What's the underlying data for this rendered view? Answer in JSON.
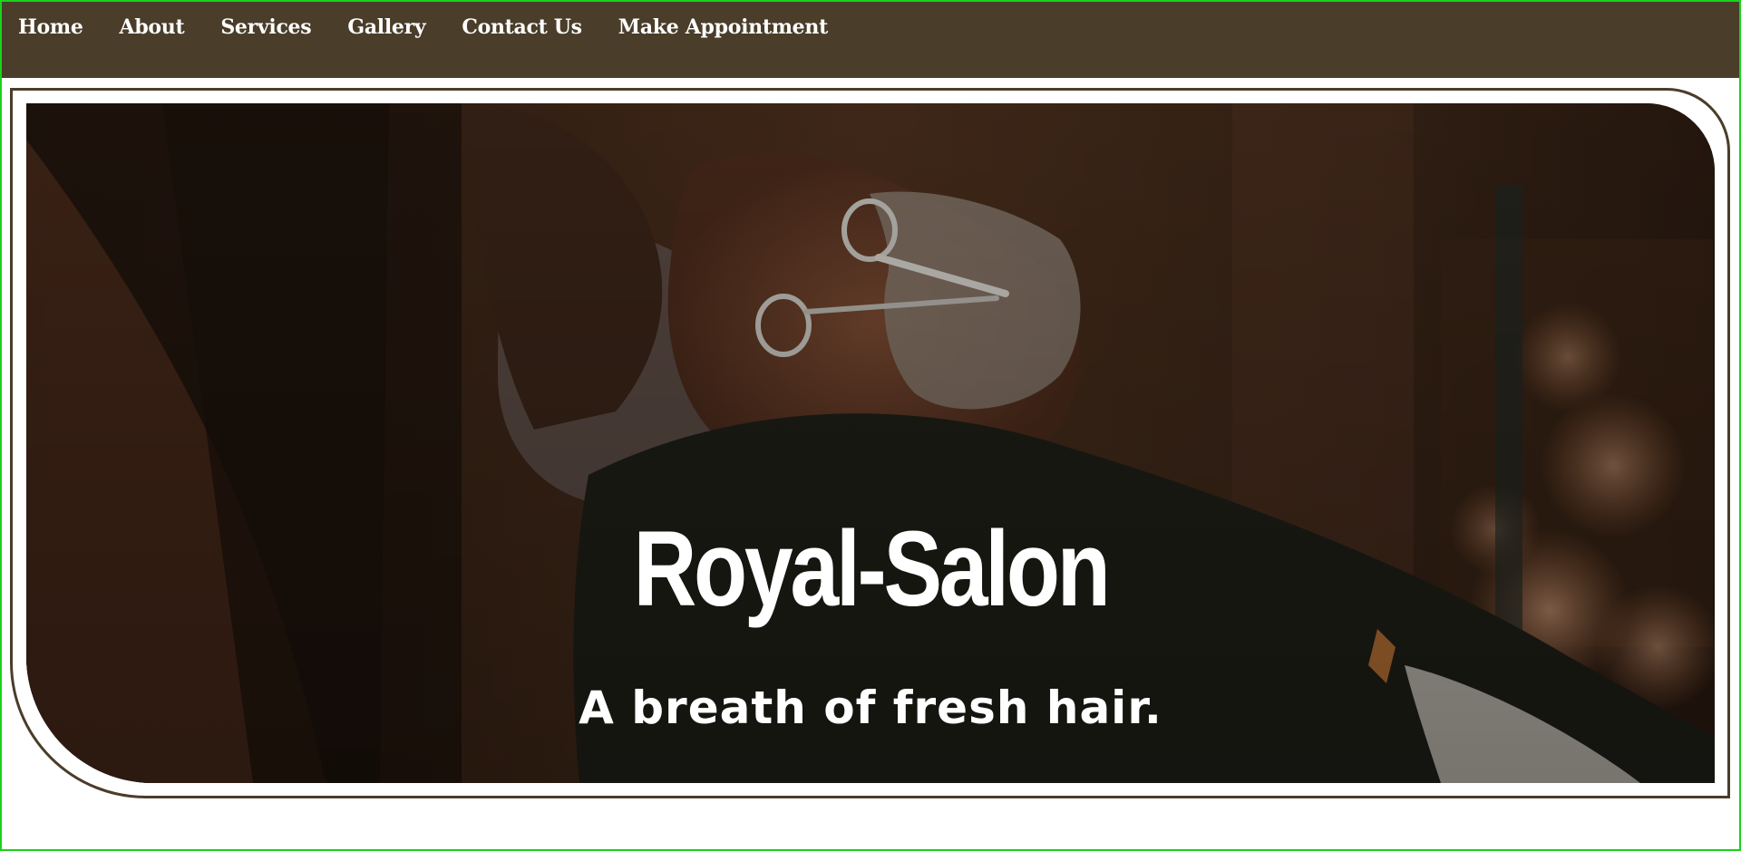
{
  "nav": {
    "items": [
      {
        "label": "Home"
      },
      {
        "label": "About"
      },
      {
        "label": "Services"
      },
      {
        "label": "Gallery"
      },
      {
        "label": "Contact Us"
      },
      {
        "label": "Make Appointment"
      }
    ]
  },
  "hero": {
    "title": "Royal-Salon",
    "subtitle": "A breath of fresh hair."
  },
  "colors": {
    "nav_background": "#4a3d2a",
    "frame_border": "#4a3d2a",
    "page_outline": "#19d319",
    "text": "#ffffff"
  }
}
